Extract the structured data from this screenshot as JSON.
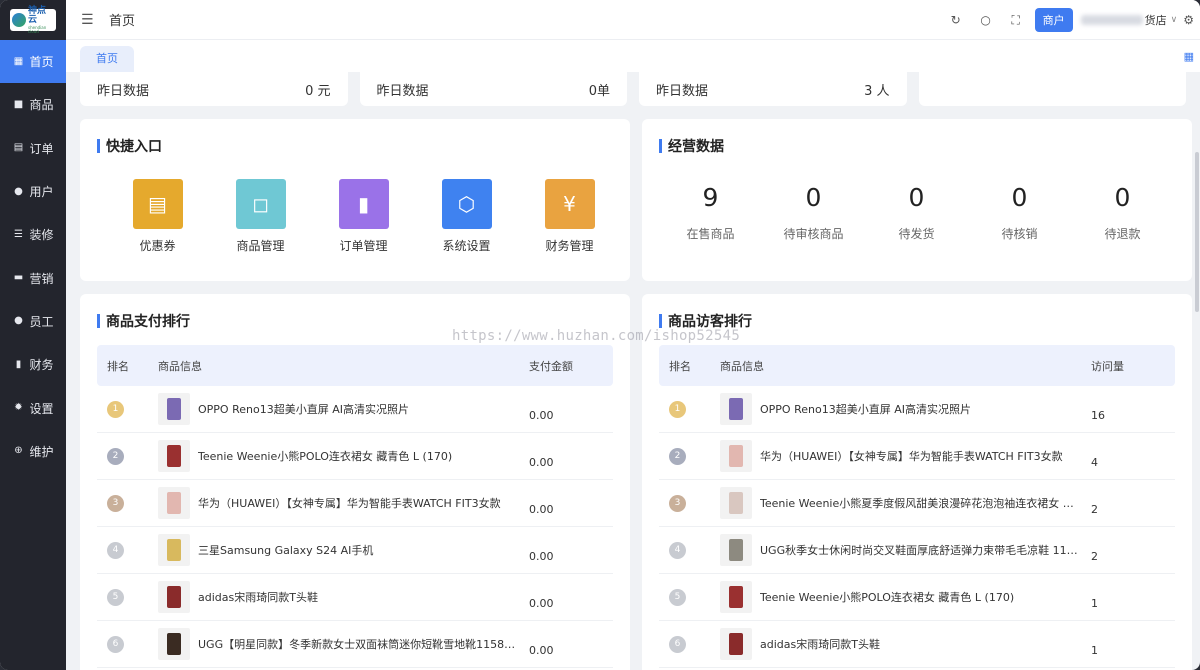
{
  "logo": {
    "title": "神点云",
    "subtitle": "shendian cloud"
  },
  "sidebar": {
    "items": [
      {
        "label": "首页",
        "icon": "grid-icon",
        "glyph": "▦"
      },
      {
        "label": "商品",
        "icon": "bag-icon",
        "glyph": "■"
      },
      {
        "label": "订单",
        "icon": "clipboard-icon",
        "glyph": "▤"
      },
      {
        "label": "用户",
        "icon": "user-icon",
        "glyph": "●"
      },
      {
        "label": "装修",
        "icon": "sliders-icon",
        "glyph": "☰"
      },
      {
        "label": "营销",
        "icon": "shop-icon",
        "glyph": "▬"
      },
      {
        "label": "员工",
        "icon": "person-icon",
        "glyph": "●"
      },
      {
        "label": "财务",
        "icon": "wallet-icon",
        "glyph": "▮"
      },
      {
        "label": "设置",
        "icon": "gear-icon",
        "glyph": "✹"
      },
      {
        "label": "维护",
        "icon": "plus-circle-icon",
        "glyph": "⊕"
      }
    ]
  },
  "header": {
    "title": "首页",
    "merchant_label": "商户",
    "store_suffix": "货店"
  },
  "tabs": [
    {
      "label": "首页"
    }
  ],
  "stats": [
    {
      "label": "昨日数据",
      "value": "0 元"
    },
    {
      "label": "昨日数据",
      "value": "0单"
    },
    {
      "label": "昨日数据",
      "value": "3 人"
    },
    {
      "label": "",
      "value": ""
    }
  ],
  "quick_entry": {
    "title": "快捷入口",
    "items": [
      {
        "label": "优惠券",
        "icon": "ticket-icon",
        "color": "#e5a92d",
        "glyph": "▤"
      },
      {
        "label": "商品管理",
        "icon": "shopping-bag-icon",
        "color": "#6fc8d4",
        "glyph": "◻"
      },
      {
        "label": "订单管理",
        "icon": "clipboard-icon",
        "color": "#9a72e8",
        "glyph": "▮"
      },
      {
        "label": "系统设置",
        "icon": "hexagon-icon",
        "color": "#3f82f0",
        "glyph": "⬡"
      },
      {
        "label": "财务管理",
        "icon": "money-bag-icon",
        "color": "#e9a340",
        "glyph": "¥"
      }
    ]
  },
  "business": {
    "title": "经营数据",
    "metrics": [
      {
        "value": "9",
        "label": "在售商品"
      },
      {
        "value": "0",
        "label": "待审核商品"
      },
      {
        "value": "0",
        "label": "待发货"
      },
      {
        "value": "0",
        "label": "待核销"
      },
      {
        "value": "0",
        "label": "待退款"
      }
    ]
  },
  "pay_rank": {
    "title": "商品支付排行",
    "columns": [
      "排名",
      "商品信息",
      "支付金额"
    ],
    "rows": [
      {
        "rank": "1",
        "name": "OPPO Reno13超美小直屏 AI高清实况照片",
        "value": "0.00",
        "thumb": "#7b6ab3"
      },
      {
        "rank": "2",
        "name": "Teenie Weenie小熊POLO连衣裙女 藏青色 L (170)",
        "value": "0.00",
        "thumb": "#9a3030"
      },
      {
        "rank": "3",
        "name": "华为（HUAWEI）【女神专属】华为智能手表WATCH FIT3女款",
        "value": "0.00",
        "thumb": "#e2b7b0"
      },
      {
        "rank": "4",
        "name": "三星Samsung Galaxy S24 AI手机",
        "value": "0.00",
        "thumb": "#d8b95e"
      },
      {
        "rank": "5",
        "name": "adidas宋雨琦同款T头鞋",
        "value": "0.00",
        "thumb": "#8a2b2b"
      },
      {
        "rank": "6",
        "name": "UGG【明星同款】冬季新款女士双面袜筒迷你短靴雪地靴1158275...",
        "value": "0.00",
        "thumb": "#3a2b22"
      }
    ]
  },
  "visit_rank": {
    "title": "商品访客排行",
    "columns": [
      "排名",
      "商品信息",
      "访问量"
    ],
    "rows": [
      {
        "rank": "1",
        "name": "OPPO Reno13超美小直屏 AI高清实况照片",
        "value": "16",
        "thumb": "#7b6ab3"
      },
      {
        "rank": "2",
        "name": "华为（HUAWEI）【女神专属】华为智能手表WATCH FIT3女款",
        "value": "4",
        "thumb": "#e2b7b0"
      },
      {
        "rank": "3",
        "name": "Teenie Weenie小熊夏季度假风甜美浪漫碎花泡泡袖连衣裙女 撞色 ...",
        "value": "2",
        "thumb": "#d9c7c0"
      },
      {
        "rank": "4",
        "name": "UGG秋季女士休闲时尚交叉鞋面厚底舒适弹力束带毛毛凉鞋 1121...",
        "value": "2",
        "thumb": "#8d8a80"
      },
      {
        "rank": "5",
        "name": "Teenie Weenie小熊POLO连衣裙女 藏青色 L (170)",
        "value": "1",
        "thumb": "#9a3030"
      },
      {
        "rank": "6",
        "name": "adidas宋雨琦同款T头鞋",
        "value": "1",
        "thumb": "#8a2b2b"
      }
    ]
  },
  "watermark": "https://www.huzhan.com/ishop52545",
  "colors": {
    "accent": "#3f7bf0",
    "sidebar_bg": "#23252d",
    "rank_badges": [
      "#e8c77a",
      "#a8adbd",
      "#c9b09a",
      "#c8cbd1",
      "#c8cbd1",
      "#c8cbd1"
    ]
  }
}
